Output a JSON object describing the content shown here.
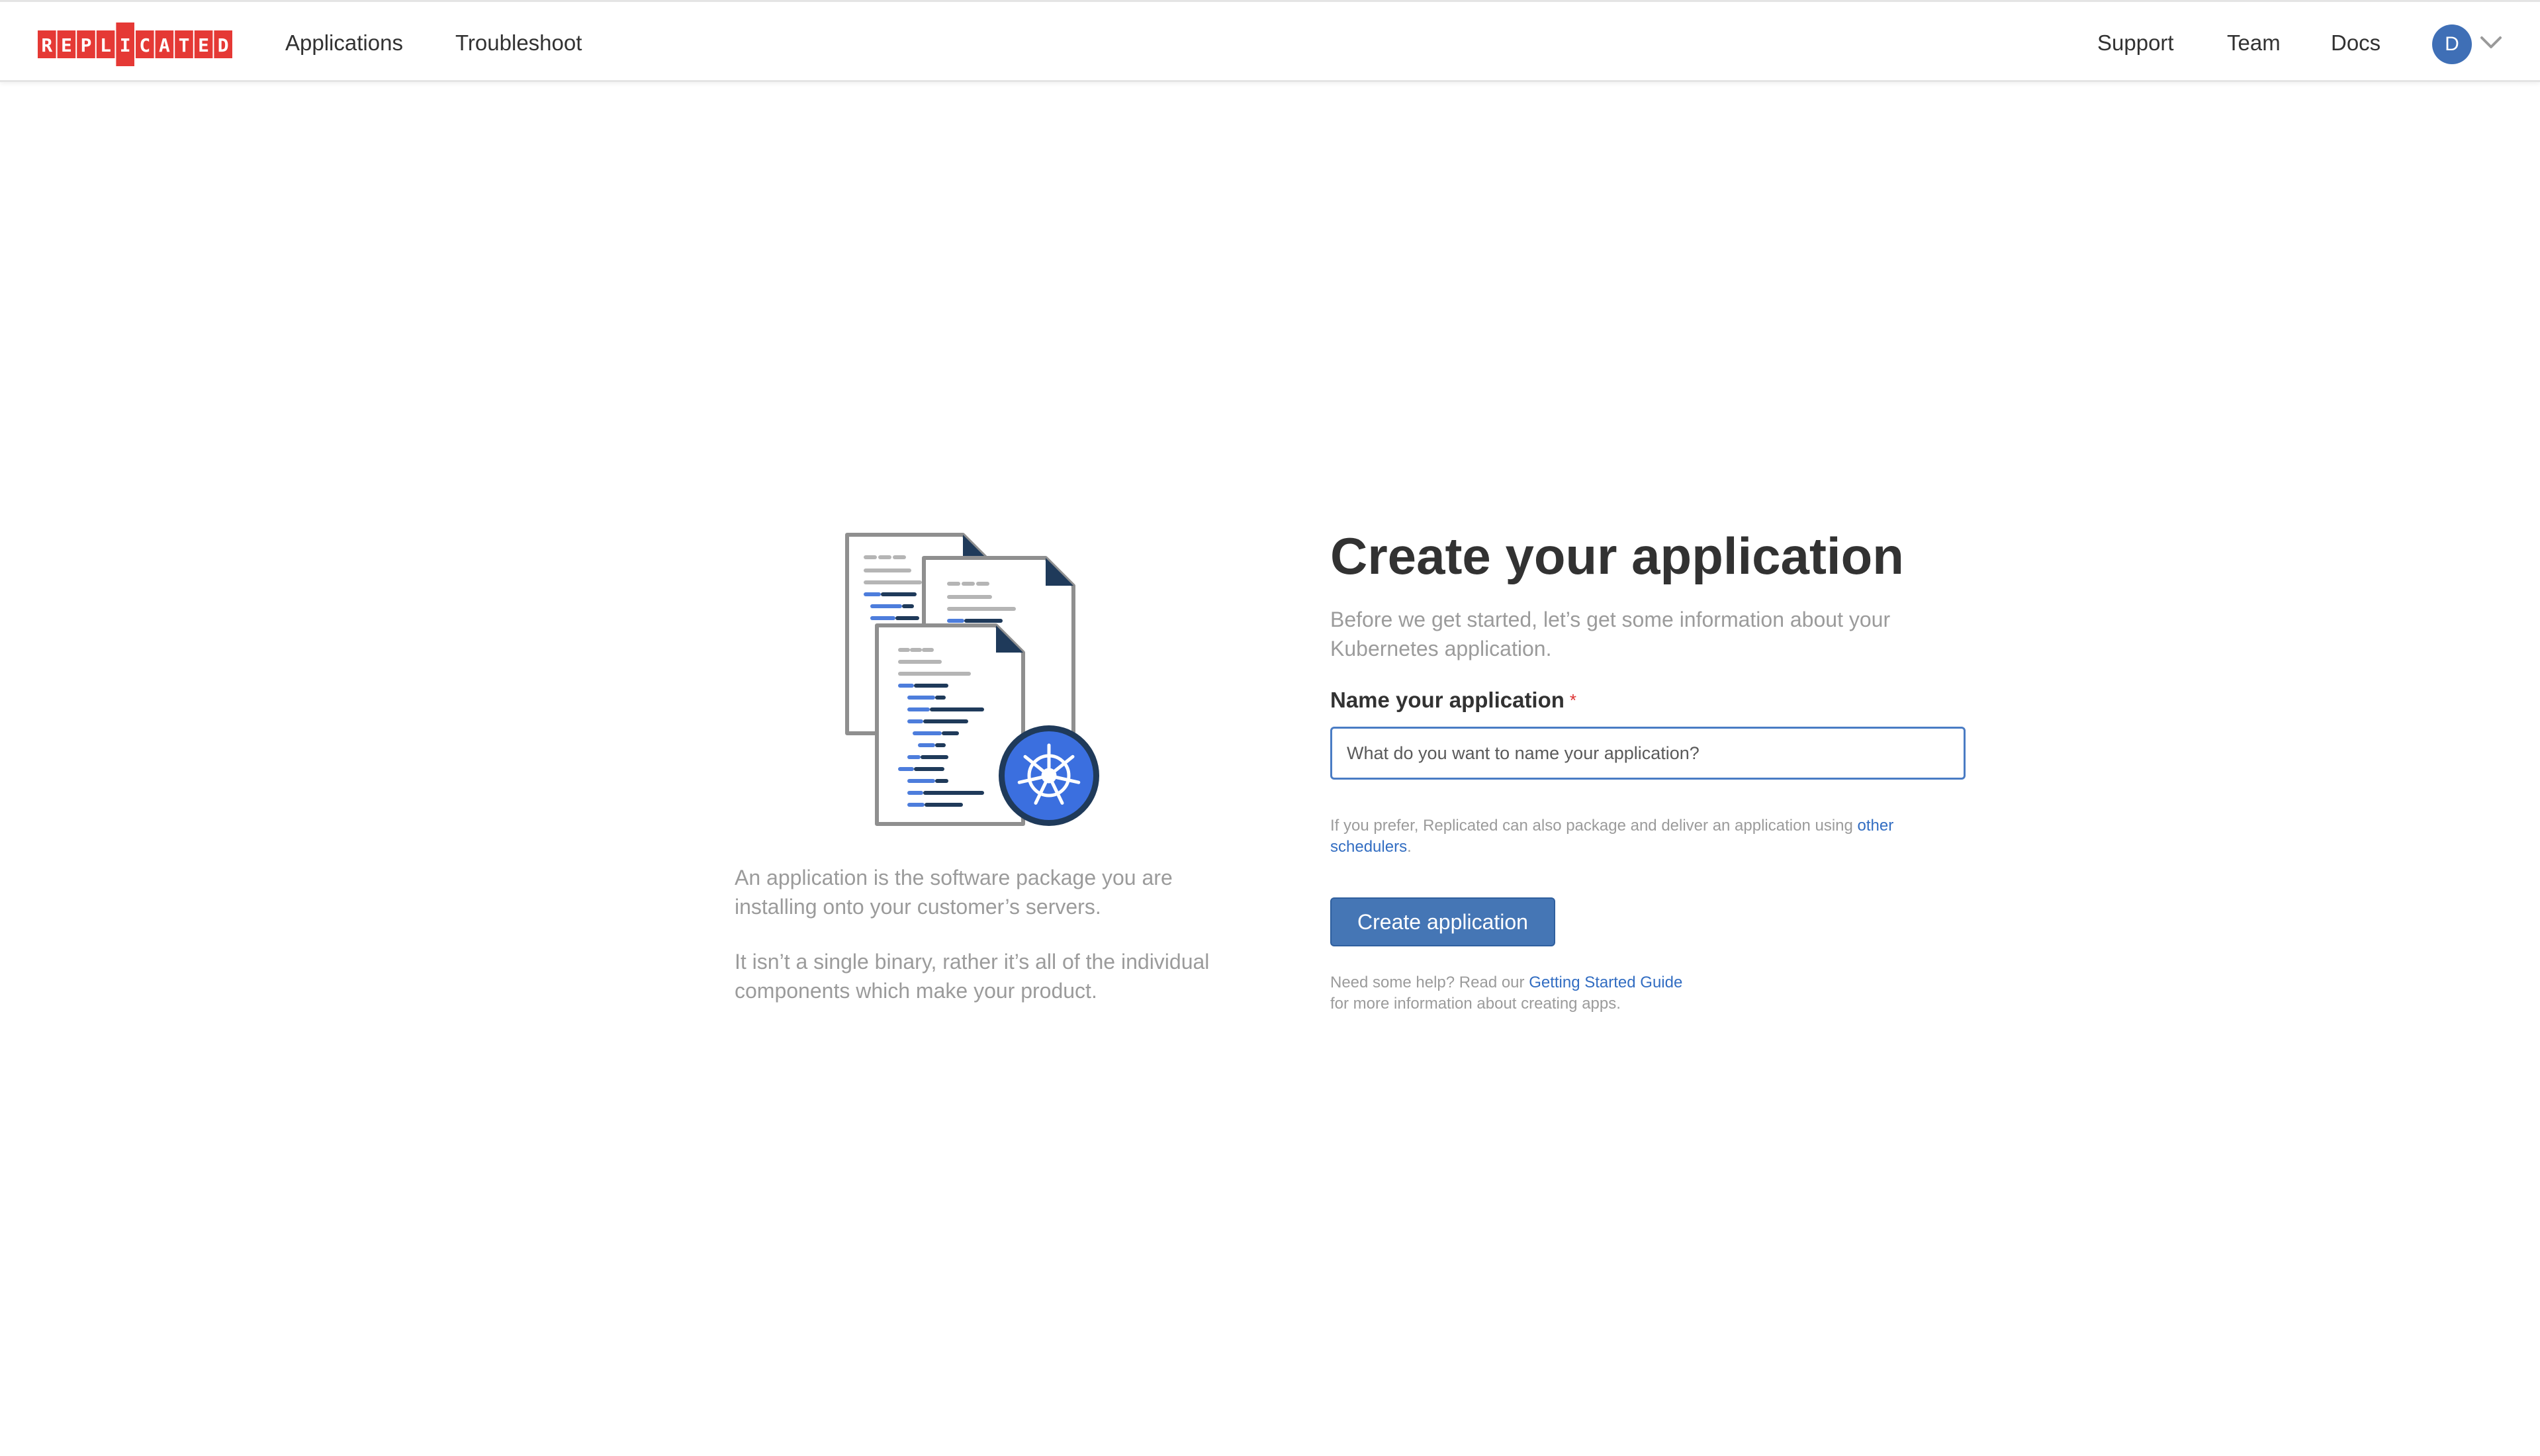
{
  "header": {
    "logo_text": "REPLICATED",
    "logo_color": "#e53935",
    "nav_left": [
      {
        "label": "Applications"
      },
      {
        "label": "Troubleshoot"
      }
    ],
    "nav_right": [
      {
        "label": "Support"
      },
      {
        "label": "Team"
      },
      {
        "label": "Docs"
      }
    ],
    "avatar_initial": "D",
    "avatar_color": "#3f6fb6",
    "menu_icon": "chevron-down-icon"
  },
  "illustration": {
    "icon": "kubernetes-documents-icon",
    "wheel_color": "#326de6"
  },
  "description": {
    "paragraph_1": "An application is the software package you are installing onto your customer’s servers.",
    "paragraph_2": "It isn’t a single binary, rather it’s all of the individual components which make your product."
  },
  "form": {
    "title": "Create your application",
    "subtitle": "Before we get started, let’s get some information about your Kubernetes application.",
    "name_label": "Name your application",
    "required_marker": "*",
    "name_value": "",
    "name_placeholder": "What do you want to name your application?",
    "schedulers_hint_prefix": "If you prefer, Replicated can also package and deliver an application using ",
    "schedulers_link": "other schedulers",
    "schedulers_hint_suffix": ".",
    "submit_label": "Create application",
    "help_prefix": "Need some help? Read our ",
    "help_link": "Getting Started Guide",
    "help_suffix": "for more information about creating apps."
  },
  "colors": {
    "accent": "#4576b5",
    "link": "#326dc2",
    "required": "#dd3333"
  }
}
